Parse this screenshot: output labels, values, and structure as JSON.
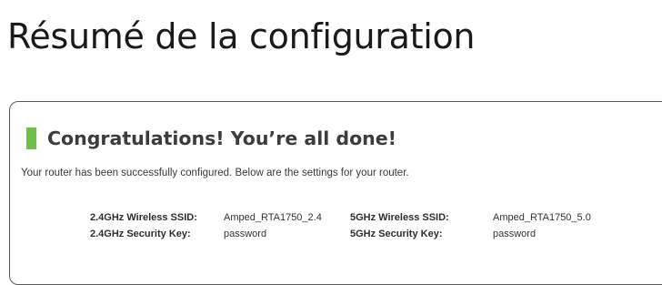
{
  "page": {
    "heading": "Résumé de la configuration"
  },
  "panel": {
    "title": "Congratulations! You’re all done!",
    "accent_color": "#6cc04a",
    "description": "Your router has been successfully configured. Below are the settings for your router."
  },
  "settings": {
    "ssid_24_label": "2.4GHz Wireless SSID:",
    "ssid_24_value": "Amped_RTA1750_2.4",
    "ssid_5_label": "5GHz Wireless SSID:",
    "ssid_5_value": "Amped_RTA1750_5.0",
    "key_24_label": "2.4GHz Security Key:",
    "key_24_value": "password",
    "key_5_label": "5GHz Security Key:",
    "key_5_value": "password"
  }
}
